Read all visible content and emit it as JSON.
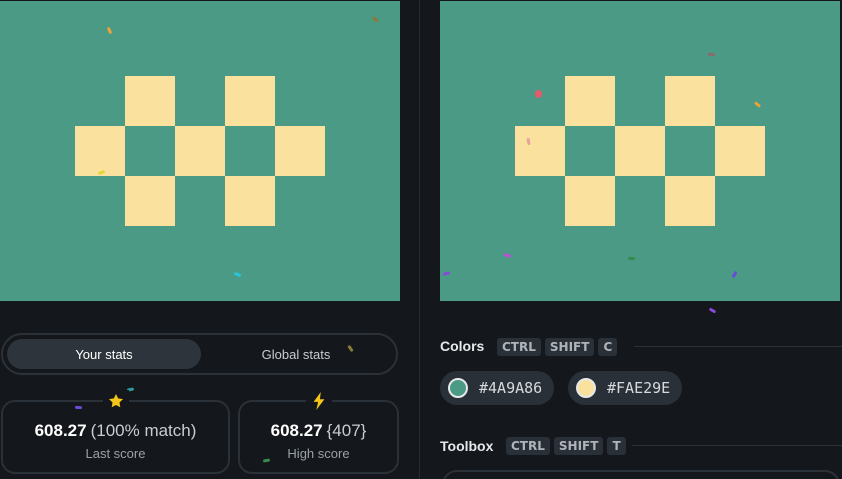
{
  "colors": {
    "background": "#4A9A86",
    "tile": "#FAE29E"
  },
  "stats_tabs": {
    "your_stats": "Your stats",
    "global_stats": "Global stats"
  },
  "last_score": {
    "icon": "star-icon",
    "value": "608.27",
    "detail": "(100% match)",
    "label": "Last score"
  },
  "high_score": {
    "icon": "lightning-icon",
    "value": "608.27",
    "detail": "{407}",
    "label": "High score"
  },
  "colors_section": {
    "title": "Colors",
    "shortcut": [
      "CTRL",
      "SHIFT",
      "C"
    ],
    "swatches": [
      "#4A9A86",
      "#FAE29E"
    ]
  },
  "toolbox_section": {
    "title": "Toolbox",
    "shortcut": [
      "CTRL",
      "SHIFT",
      "T"
    ]
  }
}
